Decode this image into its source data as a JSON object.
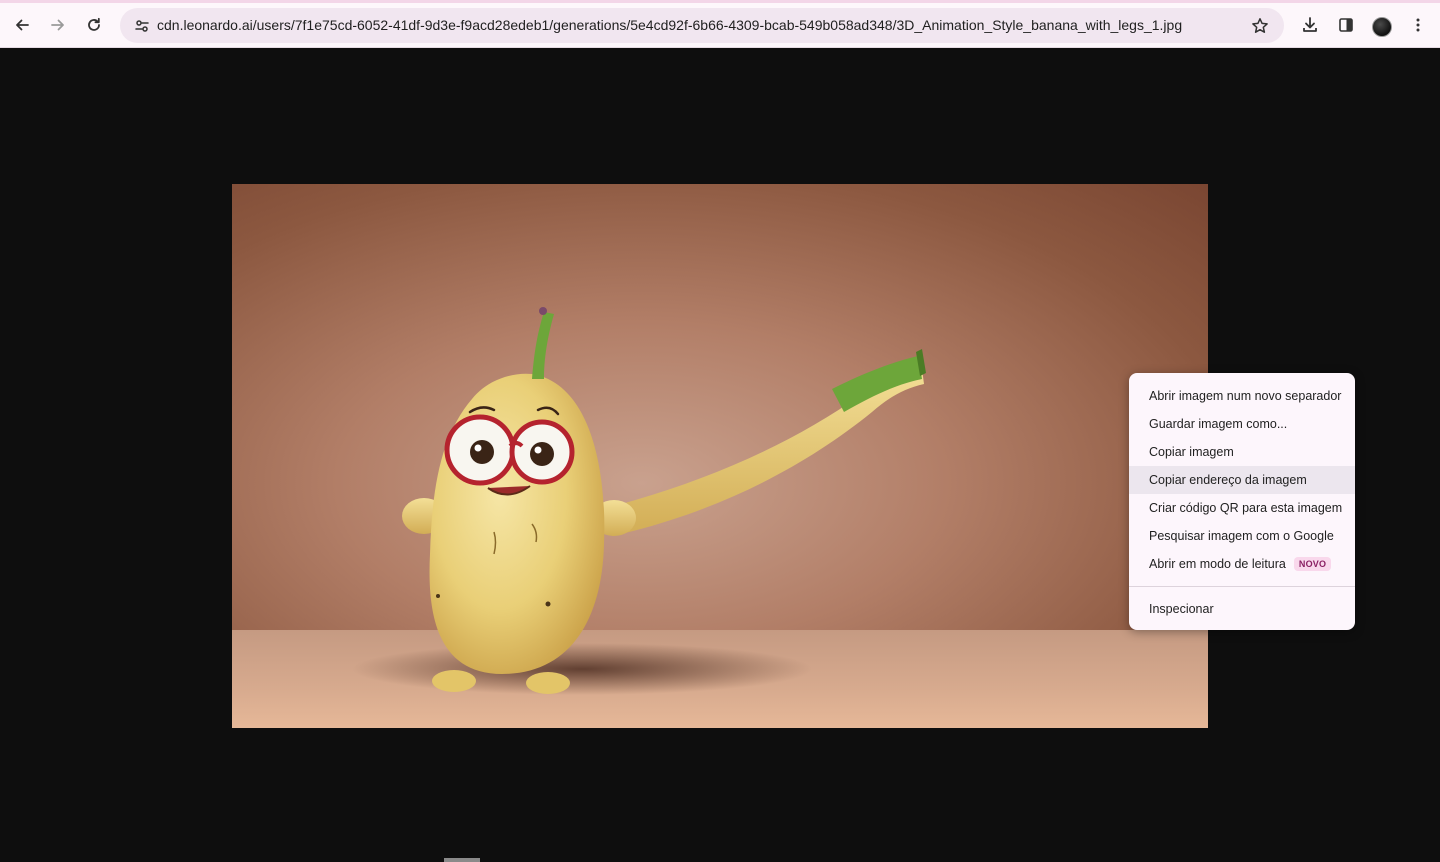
{
  "browser": {
    "url": "cdn.leonardo.ai/users/7f1e75cd-6052-41df-9d3e-f9acd28edeb1/generations/5e4cd92f-6b66-4309-bcab-549b058ad348/3D_Animation_Style_banana_with_legs_1.jpg",
    "icons": {
      "back": "arrow-left-icon",
      "forward": "arrow-right-icon",
      "reload": "reload-icon",
      "site_info": "tune-icon",
      "bookmark": "star-icon",
      "downloads": "download-icon",
      "side_panel": "side-panel-icon",
      "menu": "kebab-menu-icon"
    },
    "accent_color": "#f3d6e8"
  },
  "viewer": {
    "background_color": "#0e0e0e"
  },
  "context_menu": {
    "items": [
      {
        "label": "Abrir imagem num novo separador"
      },
      {
        "label": "Guardar imagem como..."
      },
      {
        "label": "Copiar imagem"
      },
      {
        "label": "Copiar endereço da imagem"
      },
      {
        "label": "Criar código QR para esta imagem"
      },
      {
        "label": "Pesquisar imagem com o Google"
      },
      {
        "label": "Abrir em modo de leitura",
        "badge": "NOVO"
      },
      {
        "label": "Inspecionar"
      }
    ],
    "hovered_index": 3
  }
}
